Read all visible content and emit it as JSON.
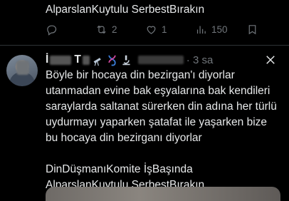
{
  "prev_tweet": {
    "text_tail": "AlparslanKuytulu SerbestBırakın",
    "retweets": "2",
    "likes": "1",
    "views": "150"
  },
  "tweet": {
    "name_initial": "İ",
    "name_second": "T",
    "time": "3 sa",
    "lines": [
      "Böyle bir hocaya din bezirgan'ı diyorlar",
      "utanmadan evine bak eşyalarına bak kendileri",
      "saraylarda saltanat sürerken din adına her türlü",
      "uydurmayı yaparken şatafat ile yaşarken bize",
      "bu hocaya din bezirganı diyorlar"
    ],
    "hashtags_line1": "DinDüşmanıKomite İşBaşında",
    "hashtags_line2": "AlparslanKuytulu SerbestBırakın"
  },
  "colors": {
    "bg": "#000000",
    "text": "#e7e9ea",
    "muted": "#71767b",
    "divider": "#2f3336"
  },
  "icons": [
    "reply-icon",
    "retweet-icon",
    "like-icon",
    "views-icon",
    "bookmark-icon",
    "telescope-emoji",
    "dna-emoji",
    "microscope-emoji",
    "close-icon"
  ]
}
